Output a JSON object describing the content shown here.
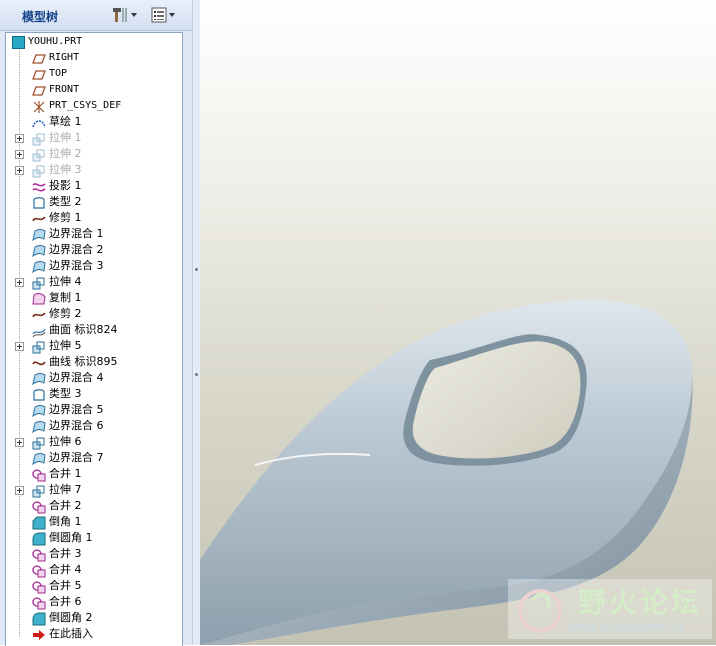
{
  "panel": {
    "title": "模型树"
  },
  "tree": {
    "root": "YOUHU.PRT",
    "items": [
      {
        "label": "RIGHT",
        "icon": "datum-plane-icon",
        "mono": true
      },
      {
        "label": "TOP",
        "icon": "datum-plane-icon",
        "mono": true
      },
      {
        "label": "FRONT",
        "icon": "datum-plane-icon",
        "mono": true
      },
      {
        "label": "PRT_CSYS_DEF",
        "icon": "coordinate-system-icon",
        "mono": true
      },
      {
        "label": "草绘 1",
        "icon": "sketch-icon"
      },
      {
        "label": "拉伸 1",
        "icon": "extrude-icon",
        "expand": true,
        "suppressed": true
      },
      {
        "label": "拉伸 2",
        "icon": "extrude-icon",
        "expand": true,
        "suppressed": true
      },
      {
        "label": "拉伸 3",
        "icon": "extrude-icon",
        "expand": true,
        "suppressed": true
      },
      {
        "label": "投影 1",
        "icon": "projection-icon"
      },
      {
        "label": "类型 2",
        "icon": "curve-type-icon"
      },
      {
        "label": "修剪 1",
        "icon": "trim-icon"
      },
      {
        "label": "边界混合 1",
        "icon": "boundary-blend-icon"
      },
      {
        "label": "边界混合 2",
        "icon": "boundary-blend-icon"
      },
      {
        "label": "边界混合 3",
        "icon": "boundary-blend-icon"
      },
      {
        "label": "拉伸 4",
        "icon": "extrude-icon",
        "expand": true
      },
      {
        "label": "复制 1",
        "icon": "copy-icon"
      },
      {
        "label": "修剪 2",
        "icon": "trim-icon"
      },
      {
        "label": "曲面 标识824",
        "icon": "surface-icon"
      },
      {
        "label": "拉伸 5",
        "icon": "extrude-icon",
        "expand": true
      },
      {
        "label": "曲线 标识895",
        "icon": "curve-icon"
      },
      {
        "label": "边界混合 4",
        "icon": "boundary-blend-icon"
      },
      {
        "label": "类型 3",
        "icon": "curve-type-icon"
      },
      {
        "label": "边界混合 5",
        "icon": "boundary-blend-icon"
      },
      {
        "label": "边界混合 6",
        "icon": "boundary-blend-icon"
      },
      {
        "label": "拉伸 6",
        "icon": "extrude-icon",
        "expand": true
      },
      {
        "label": "边界混合 7",
        "icon": "boundary-blend-icon"
      },
      {
        "label": "合并 1",
        "icon": "merge-icon"
      },
      {
        "label": "拉伸 7",
        "icon": "extrude-icon",
        "expand": true
      },
      {
        "label": "合并 2",
        "icon": "merge-icon"
      },
      {
        "label": "倒角 1",
        "icon": "chamfer-icon"
      },
      {
        "label": "倒圆角 1",
        "icon": "round-icon"
      },
      {
        "label": "合并 3",
        "icon": "merge-icon"
      },
      {
        "label": "合并 4",
        "icon": "merge-icon"
      },
      {
        "label": "合并 5",
        "icon": "merge-icon"
      },
      {
        "label": "合并 6",
        "icon": "merge-icon"
      },
      {
        "label": "倒圆角 2",
        "icon": "round-icon"
      },
      {
        "label": "在此插入",
        "icon": "insert-here-arrow-icon"
      }
    ]
  },
  "toolbar": {
    "settings_icon": "tools-icon",
    "show_icon": "tree-display-icon"
  },
  "watermark": {
    "cn": "野火论坛",
    "url": "www.proewildfire.cn"
  },
  "colors": {
    "panel_bg": "#dfe8f6",
    "title_text": "#15428b",
    "model_surface": "#a9b9c5"
  }
}
